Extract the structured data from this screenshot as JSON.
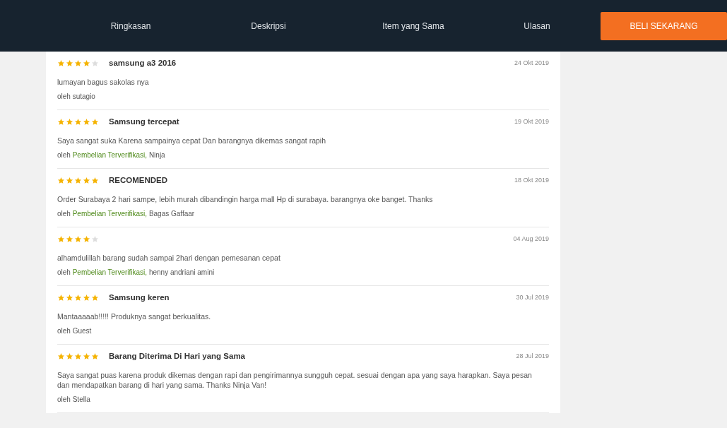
{
  "nav": {
    "tabs": [
      {
        "label": "Ringkasan",
        "selected": false
      },
      {
        "label": "Deskripsi",
        "selected": false
      },
      {
        "label": "Item yang Sama",
        "selected": false
      },
      {
        "label": "Ulasan",
        "selected": false
      }
    ],
    "buy_button": "BELI SEKARANG"
  },
  "reviews": [
    {
      "stars": 4,
      "title": "samsung a3 2016",
      "date": "24 Okt 2019",
      "text": "lumayan bagus sakolas nya",
      "by": "oleh",
      "name": "sutagio"
    },
    {
      "stars": 5,
      "title": "Samsung tercepat",
      "date": "19 Okt 2019",
      "text": "Saya sangat suka Karena sampainya cepat Dan barangnya dikemas sangat rapih",
      "by": "oleh",
      "verified": "Pembelian Terverifikasi,",
      "name": "Ninja"
    },
    {
      "stars": 5,
      "title": "RECOMENDED",
      "date": "18 Okt 2019",
      "text": "Order Surabaya 2 hari sampe, lebih murah dibandingin harga mall Hp di surabaya. barangnya oke banget. Thanks",
      "by": "oleh",
      "verified": "Pembelian Terverifikasi,",
      "name": "Bagas Gaffaar"
    },
    {
      "stars": 4,
      "date": "04 Aug 2019",
      "text": "alhamdulillah barang sudah sampai 2hari dengan pemesanan cepat",
      "by": "oleh",
      "verified": "Pembelian Terverifikasi,",
      "name": "henny andriani amini"
    },
    {
      "stars": 5,
      "title": "Samsung keren",
      "date": "30 Jul 2019",
      "text": "Mantaaaaab!!!!! Produknya sangat berkualitas.",
      "by": "oleh",
      "name": "Guest"
    },
    {
      "stars": 5,
      "title": "Barang Diterima Di Hari yang Sama",
      "date": "28 Jul 2019",
      "text": "Saya sangat puas karena produk dikemas dengan rapi dan pengirimannya sungguh cepat. sesuai dengan apa yang saya harapkan. Saya pesan dan mendapatkan barang di hari yang sama. Thanks Ninja Van!",
      "by": "oleh",
      "name": "Stella"
    }
  ]
}
